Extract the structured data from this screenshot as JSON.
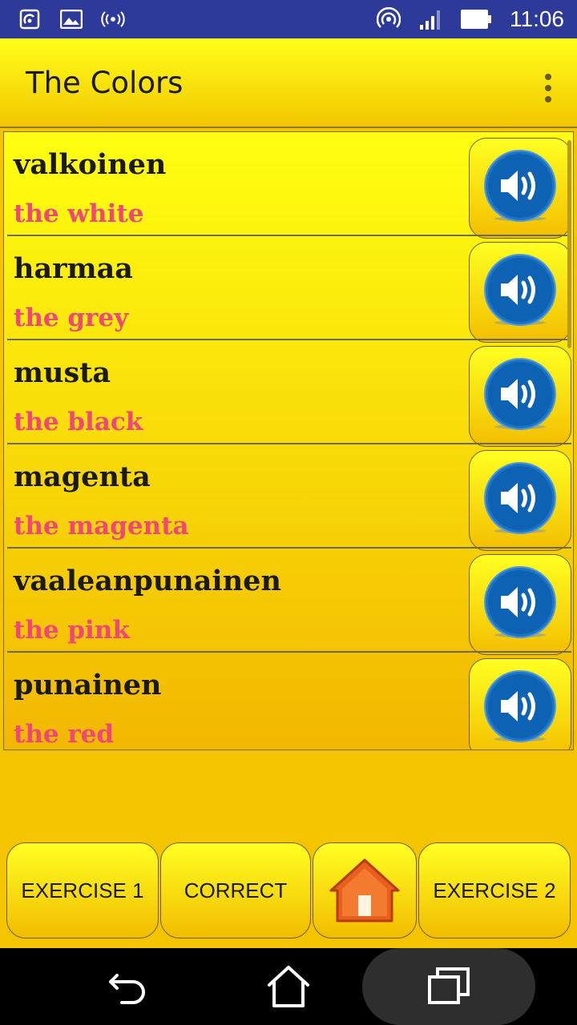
{
  "status_bar": {
    "time": "11:06",
    "icons_left": [
      "nfc-icon",
      "image-icon",
      "broadcast-icon"
    ],
    "icons_right": [
      "hotspot-icon",
      "signal-icon",
      "battery-icon"
    ]
  },
  "app_bar": {
    "title": "The Colors",
    "menu_icon": "overflow-menu-icon"
  },
  "list": {
    "items": [
      {
        "word": "valkoinen",
        "translation": "the white"
      },
      {
        "word": "harmaa",
        "translation": "the grey"
      },
      {
        "word": "musta",
        "translation": "the black"
      },
      {
        "word": "magenta",
        "translation": "the magenta"
      },
      {
        "word": "vaaleanpunainen",
        "translation": "the pink"
      },
      {
        "word": "punainen",
        "translation": "the red"
      }
    ],
    "speaker_icon": "speaker-icon"
  },
  "bottom_buttons": {
    "exercise1": "EXERCISE 1",
    "correct": "CORRECT",
    "home_icon": "home-icon",
    "exercise2": "EXERCISE 2"
  },
  "nav_bar": {
    "icons": [
      "back-icon",
      "home-nav-icon",
      "recents-icon"
    ]
  },
  "colors": {
    "status_bar": "#2d3a9a",
    "accent_yellow": "#ffff1a",
    "translation_pink": "#f0467a"
  }
}
